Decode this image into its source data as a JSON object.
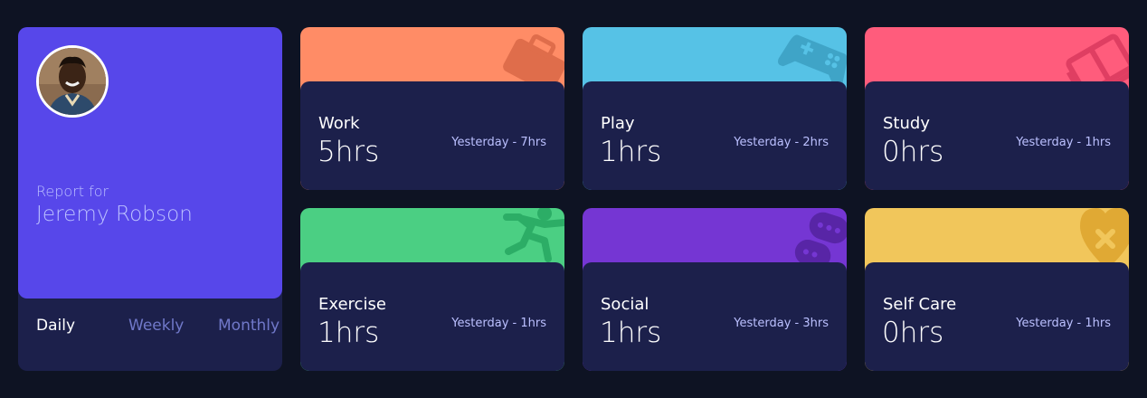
{
  "profile": {
    "report_label": "Report for",
    "name": "Jeremy Robson",
    "periods": [
      "Daily",
      "Weekly",
      "Monthly"
    ],
    "active_period": "Daily"
  },
  "colors": {
    "background": "#0e1323",
    "profile_accent": "#5747ea",
    "card_body": "#1c204b",
    "muted_text": "#bbc0ff",
    "period_text": "#7078c9"
  },
  "cards": [
    {
      "title": "Work",
      "current": "5hrs",
      "previous": "Yesterday - 7hrs",
      "color": "#ff8c66",
      "icon": "briefcase-icon"
    },
    {
      "title": "Play",
      "current": "1hrs",
      "previous": "Yesterday - 2hrs",
      "color": "#56c2e6",
      "icon": "gamepad-icon"
    },
    {
      "title": "Study",
      "current": "0hrs",
      "previous": "Yesterday - 1hrs",
      "color": "#ff5c7c",
      "icon": "book-icon"
    },
    {
      "title": "Exercise",
      "current": "1hrs",
      "previous": "Yesterday - 1hrs",
      "color": "#4bcf83",
      "icon": "running-icon"
    },
    {
      "title": "Social",
      "current": "1hrs",
      "previous": "Yesterday - 3hrs",
      "color": "#7536d3",
      "icon": "chat-icon"
    },
    {
      "title": "Self Care",
      "current": "0hrs",
      "previous": "Yesterday - 1hrs",
      "color": "#f1c65b",
      "icon": "heart-icon"
    }
  ]
}
